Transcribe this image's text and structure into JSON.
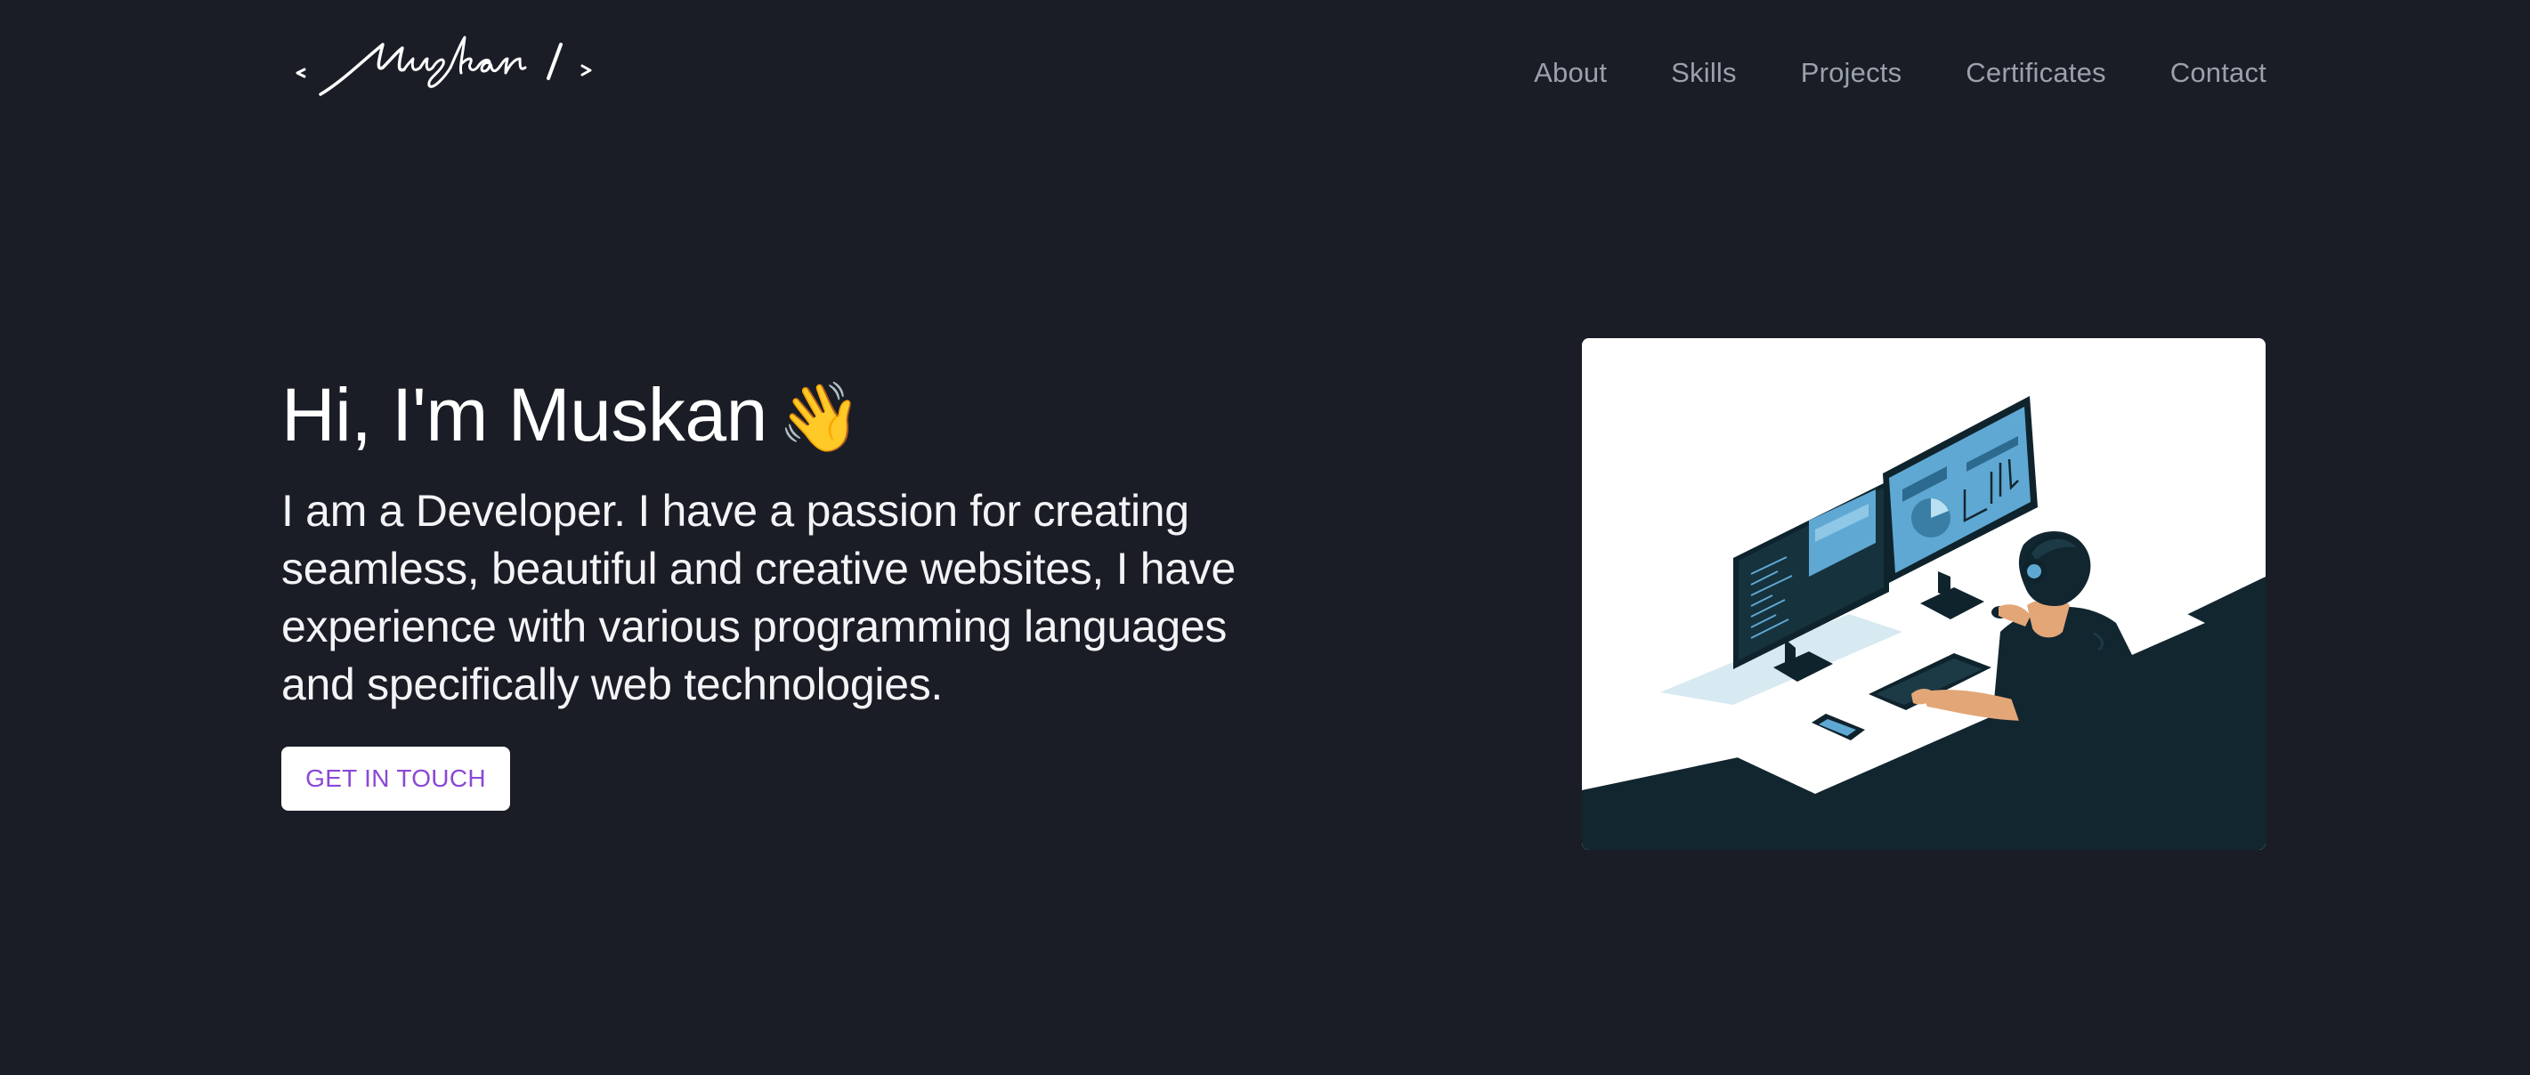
{
  "header": {
    "logo_text": "< Muskan / >",
    "nav": [
      {
        "label": "About"
      },
      {
        "label": "Skills"
      },
      {
        "label": "Projects"
      },
      {
        "label": "Certificates"
      },
      {
        "label": "Contact"
      }
    ]
  },
  "hero": {
    "greeting": "Hi, I'm Muskan",
    "wave_emoji": "👋",
    "description": "I am a Developer. I have a passion for creating seamless, beautiful and creative websites, I have experience with various programming languages and specifically web technologies.",
    "cta_label": "GET IN TOUCH",
    "illustration_icon": "developer-at-desk-illustration"
  },
  "colors": {
    "background": "#1a1d26",
    "nav_text": "#9aa1ad",
    "cta_text": "#8b48d6",
    "illustration_dark": "#12262f",
    "illustration_accent": "#5fa8d3"
  }
}
